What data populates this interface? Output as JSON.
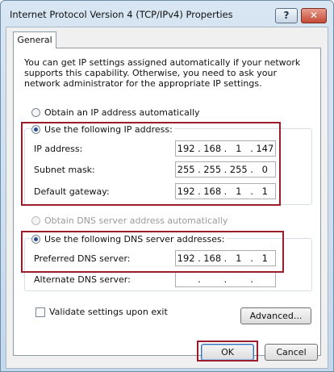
{
  "window": {
    "title": "Internet Protocol Version 4 (TCP/IPv4) Properties",
    "help_label": "?",
    "close_label": "✕"
  },
  "tabs": [
    {
      "label": "General"
    }
  ],
  "description": "You can get IP settings assigned automatically if your network supports this capability. Otherwise, you need to ask your network administrator for the appropriate IP settings.",
  "ip_section": {
    "auto_label": "Obtain an IP address automatically",
    "manual_label": "Use the following IP address:",
    "selected": "manual",
    "fields": [
      {
        "label": "IP address:",
        "octets": [
          "192",
          "168",
          "1",
          "147"
        ]
      },
      {
        "label": "Subnet mask:",
        "octets": [
          "255",
          "255",
          "255",
          "0"
        ]
      },
      {
        "label": "Default gateway:",
        "octets": [
          "192",
          "168",
          "1",
          "1"
        ]
      }
    ]
  },
  "dns_section": {
    "auto_label": "Obtain DNS server address automatically",
    "manual_label": "Use the following DNS server addresses:",
    "selected": "manual",
    "fields": [
      {
        "label": "Preferred DNS server:",
        "octets": [
          "192",
          "168",
          "1",
          "1"
        ]
      },
      {
        "label": "Alternate DNS server:",
        "octets": [
          "",
          "",
          "",
          ""
        ]
      }
    ]
  },
  "validate": {
    "label": "Validate settings upon exit",
    "checked": false
  },
  "buttons": {
    "advanced": "Advanced...",
    "ok": "OK",
    "cancel": "Cancel"
  },
  "colors": {
    "highlight_border": "#9b1c2b",
    "title_bar": "#c4d8ec",
    "close_button": "#c44a33"
  }
}
